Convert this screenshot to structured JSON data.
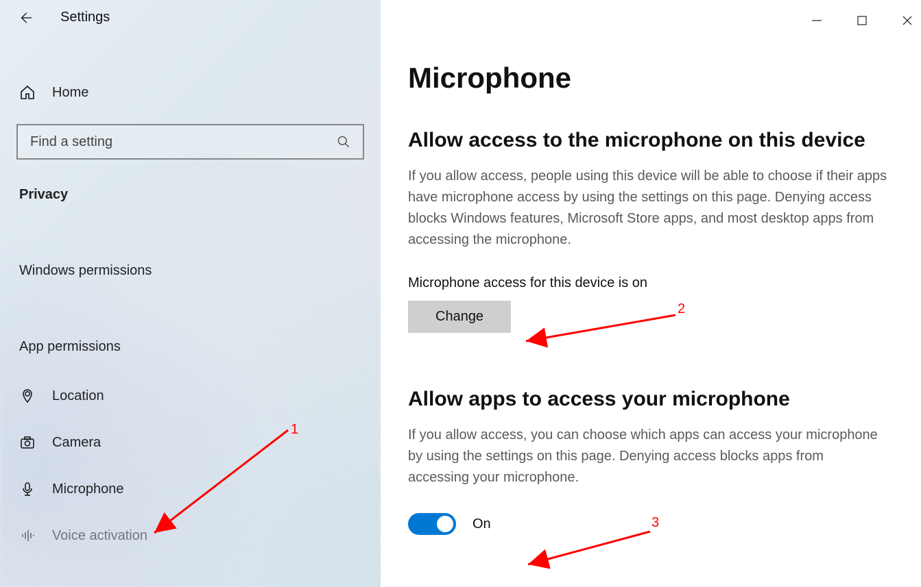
{
  "header": {
    "title": "Settings"
  },
  "sidebar": {
    "home": "Home",
    "search_placeholder": "Find a setting",
    "privacy": "Privacy",
    "windows_permissions": "Windows permissions",
    "app_permissions": "App permissions",
    "items": {
      "location": "Location",
      "camera": "Camera",
      "microphone": "Microphone",
      "voice_activation": "Voice activation"
    }
  },
  "main": {
    "title": "Microphone",
    "section1": {
      "heading": "Allow access to the microphone on this device",
      "body": "If you allow access, people using this device will be able to choose if their apps have microphone access by using the settings on this page. Denying access blocks Windows features, Microsoft Store apps, and most desktop apps from accessing the microphone.",
      "status": "Microphone access for this device is on",
      "change_button": "Change"
    },
    "section2": {
      "heading": "Allow apps to access your microphone",
      "body": "If you allow access, you can choose which apps can access your microphone by using the settings on this page. Denying access blocks apps from accessing your microphone.",
      "toggle_label": "On",
      "toggle_state": true
    }
  },
  "annotations": {
    "a1": "1",
    "a2": "2",
    "a3": "3"
  }
}
